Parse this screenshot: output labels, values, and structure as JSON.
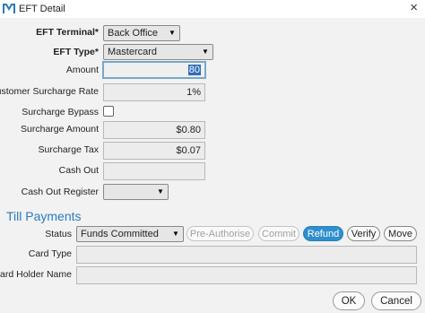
{
  "window": {
    "title": "EFT Detail",
    "close_glyph": "×",
    "icon": "m-logo-icon"
  },
  "form": {
    "eft_terminal": {
      "label": "EFT Terminal",
      "required_mark": "*",
      "value": "Back Office"
    },
    "eft_type": {
      "label": "EFT Type",
      "required_mark": "*",
      "value": "Mastercard"
    },
    "amount": {
      "label": "Amount",
      "value": "80"
    },
    "customer_surcharge_rate": {
      "label": "Customer Surcharge Rate",
      "value": "1%"
    },
    "surcharge_bypass": {
      "label": "Surcharge Bypass",
      "checked": false
    },
    "surcharge_amount": {
      "label": "Surcharge Amount",
      "value": "$0.80"
    },
    "surcharge_tax": {
      "label": "Surcharge Tax",
      "value": "$0.07"
    },
    "cash_out": {
      "label": "Cash Out",
      "value": ""
    },
    "cash_out_register": {
      "label": "Cash Out Register",
      "value": ""
    }
  },
  "till_payments": {
    "title": "Till Payments",
    "status": {
      "label": "Status",
      "value": "Funds Committed"
    },
    "actions": {
      "pre_authorise": "Pre-Authorise",
      "commit": "Commit",
      "refund": "Refund",
      "verify": "Verify",
      "move": "Move"
    },
    "card_type": {
      "label": "Card Type",
      "value": ""
    },
    "card_holder_name": {
      "label": "Card Holder Name",
      "value": ""
    }
  },
  "footer": {
    "ok_label": "OK",
    "cancel_label": "Cancel"
  },
  "colors": {
    "accent": "#2b7bb9",
    "refund_button": "#2f8fce",
    "selection": "#2f6fb5"
  }
}
